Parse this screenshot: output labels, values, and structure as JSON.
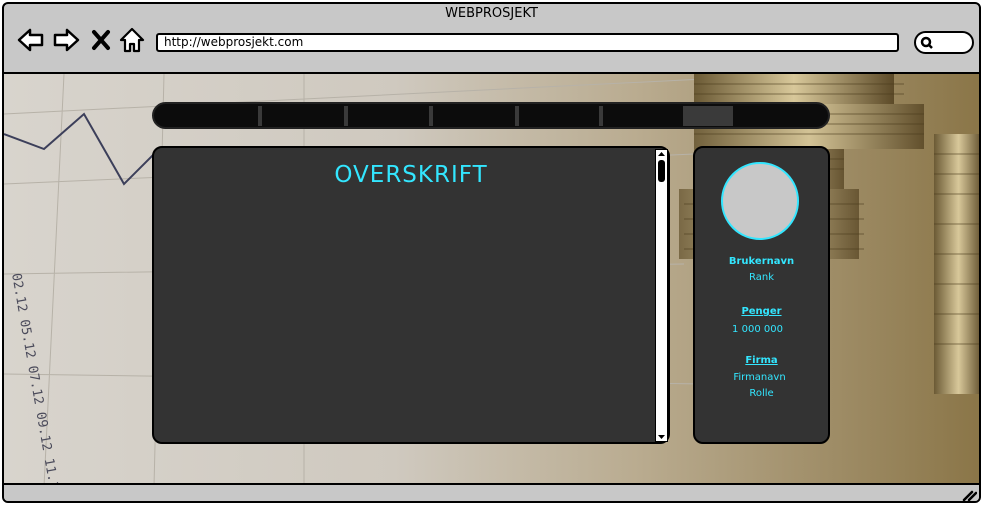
{
  "browser": {
    "title": "WEBPROSJEKT",
    "url": "http://webprosjekt.com"
  },
  "main": {
    "heading": "OVERSKRIFT"
  },
  "profile": {
    "username": "Brukernavn",
    "rank": "Rank",
    "money_label": "Penger",
    "money_value": "1 000 000",
    "company_label": "Firma",
    "company_name": "Firmanavn",
    "role": "Rolle"
  },
  "colors": {
    "accent": "#33e6ff",
    "panel": "#333333",
    "menubar": "#0c0c0c"
  },
  "icons": [
    "back-icon",
    "forward-icon",
    "stop-icon",
    "home-icon",
    "search-icon",
    "resize-icon"
  ]
}
